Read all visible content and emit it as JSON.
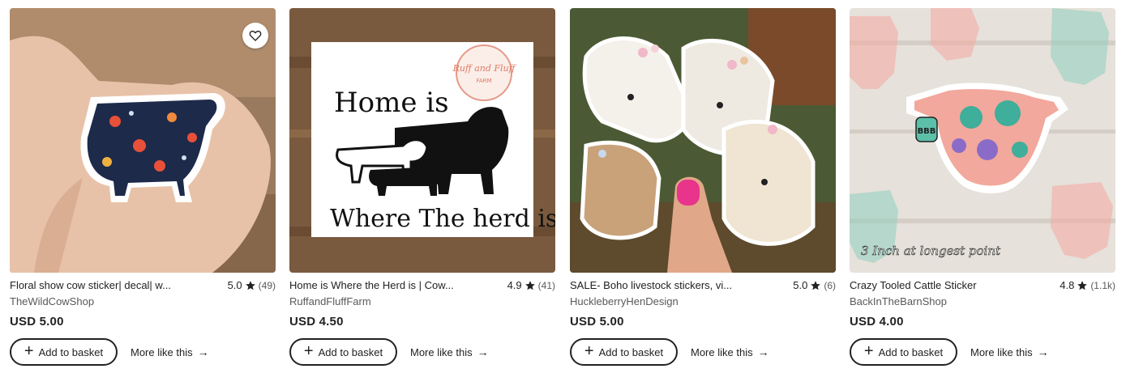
{
  "colors": {
    "text": "#222222",
    "muted": "#595959",
    "border": "#222222"
  },
  "icons": {
    "favorite": "heart-icon",
    "rating": "star-icon",
    "add": "plus-icon",
    "more": "arrow-right-icon"
  },
  "listings": [
    {
      "title": "Floral show cow sticker| decal| w...",
      "rating": "5.0",
      "reviews": "(49)",
      "shop": "TheWildCowShop",
      "price": "USD 5.00",
      "add_label": "Add to basket",
      "more_label": "More like this"
    },
    {
      "title": "Home is Where the Herd is | Cow...",
      "rating": "4.9",
      "reviews": "(41)",
      "shop": "RuffandFluffFarm",
      "price": "USD 4.50",
      "add_label": "Add to basket",
      "more_label": "More like this",
      "image_text": {
        "line1": "Home is",
        "line2": "Where The herd is",
        "logo_line1": "Ruff and Fluff",
        "logo_line2": "FARM"
      }
    },
    {
      "title": "SALE- Boho livestock stickers, vi...",
      "rating": "5.0",
      "reviews": "(6)",
      "shop": "HuckleberryHenDesign",
      "price": "USD 5.00",
      "add_label": "Add to basket",
      "more_label": "More like this"
    },
    {
      "title": "Crazy Tooled Cattle Sticker",
      "rating": "4.8",
      "reviews": "(1.1k)",
      "shop": "BackInTheBarnShop",
      "price": "USD 4.00",
      "add_label": "Add to basket",
      "more_label": "More like this",
      "image_text": {
        "tag": "BBB",
        "caption": "3 Inch at longest point"
      }
    }
  ]
}
